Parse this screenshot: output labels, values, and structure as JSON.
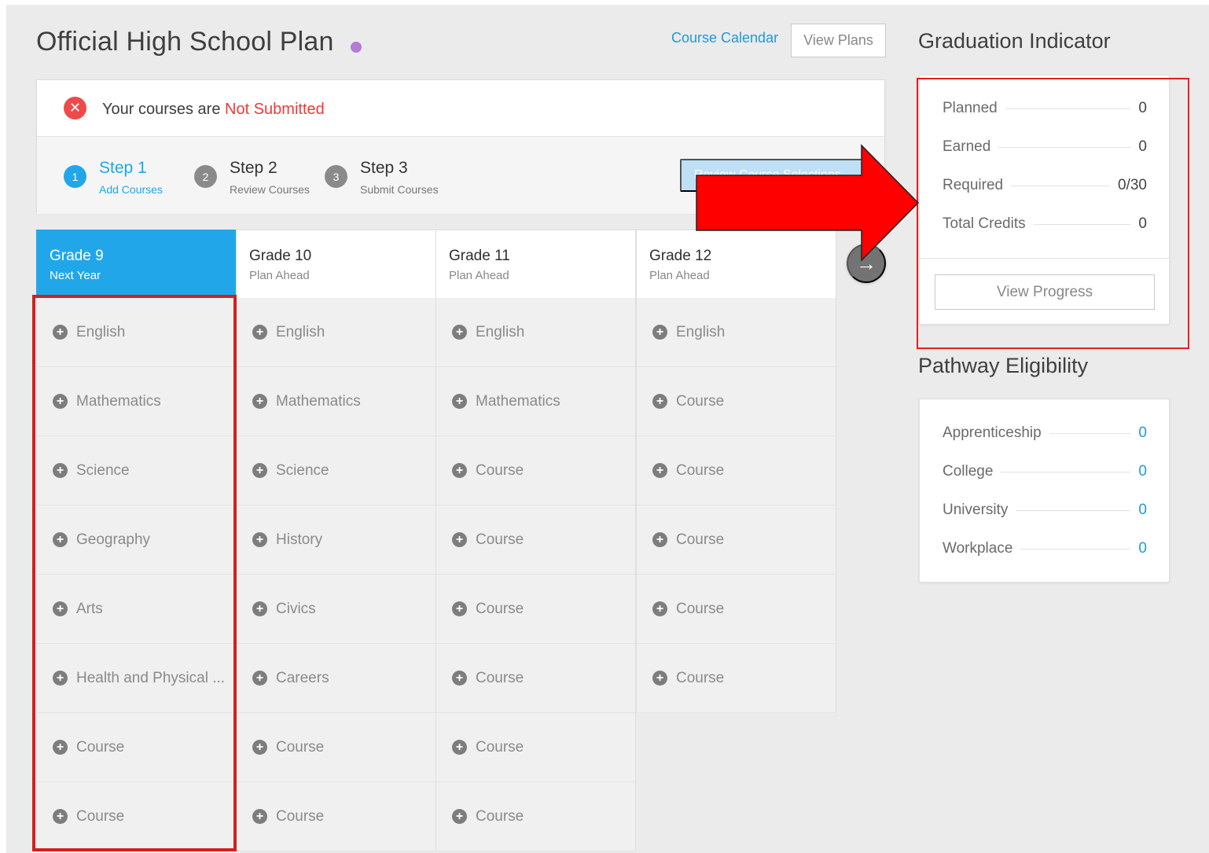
{
  "page": {
    "title": "Official High School Plan",
    "course_calendar_link": "Course Calendar",
    "view_plans_button": "View Plans"
  },
  "status": {
    "prefix": "Your courses are ",
    "state": "Not Submitted",
    "icon": "x-circle-icon"
  },
  "steps": [
    {
      "number": "1",
      "title": "Step 1",
      "subtitle": "Add Courses",
      "active": true
    },
    {
      "number": "2",
      "title": "Step 2",
      "subtitle": "Review Courses",
      "active": false
    },
    {
      "number": "3",
      "title": "Step 3",
      "subtitle": "Submit Courses",
      "active": false
    }
  ],
  "review_button": "Review Course Selections",
  "grades": [
    {
      "title": "Grade 9",
      "subtitle": "Next Year",
      "active": true,
      "courses": [
        "English",
        "Mathematics",
        "Science",
        "Geography",
        "Arts",
        "Health and Physical ...",
        "Course",
        "Course"
      ]
    },
    {
      "title": "Grade 10",
      "subtitle": "Plan Ahead",
      "active": false,
      "courses": [
        "English",
        "Mathematics",
        "Science",
        "History",
        "Civics",
        "Careers",
        "Course",
        "Course"
      ]
    },
    {
      "title": "Grade 11",
      "subtitle": "Plan Ahead",
      "active": false,
      "courses": [
        "English",
        "Mathematics",
        "Course",
        "Course",
        "Course",
        "Course",
        "Course",
        "Course"
      ]
    },
    {
      "title": "Grade 12",
      "subtitle": "Plan Ahead",
      "active": false,
      "courses": [
        "English",
        "Course",
        "Course",
        "Course",
        "Course",
        "Course"
      ]
    }
  ],
  "graduation": {
    "heading": "Graduation Indicator",
    "metrics": [
      {
        "label": "Planned",
        "value": "0"
      },
      {
        "label": "Earned",
        "value": "0"
      },
      {
        "label": "Required",
        "value": "0/30"
      },
      {
        "label": "Total Credits",
        "value": "0"
      }
    ],
    "button": "View Progress"
  },
  "pathway": {
    "heading": "Pathway Eligibility",
    "metrics": [
      {
        "label": "Apprenticeship",
        "value": "0"
      },
      {
        "label": "College",
        "value": "0"
      },
      {
        "label": "University",
        "value": "0"
      },
      {
        "label": "Workplace",
        "value": "0"
      }
    ]
  },
  "colors": {
    "accent_blue": "#22a6ea",
    "error_red": "#f0383a",
    "annotation_red": "#ff0000",
    "title_dot": "#b57bd6"
  }
}
